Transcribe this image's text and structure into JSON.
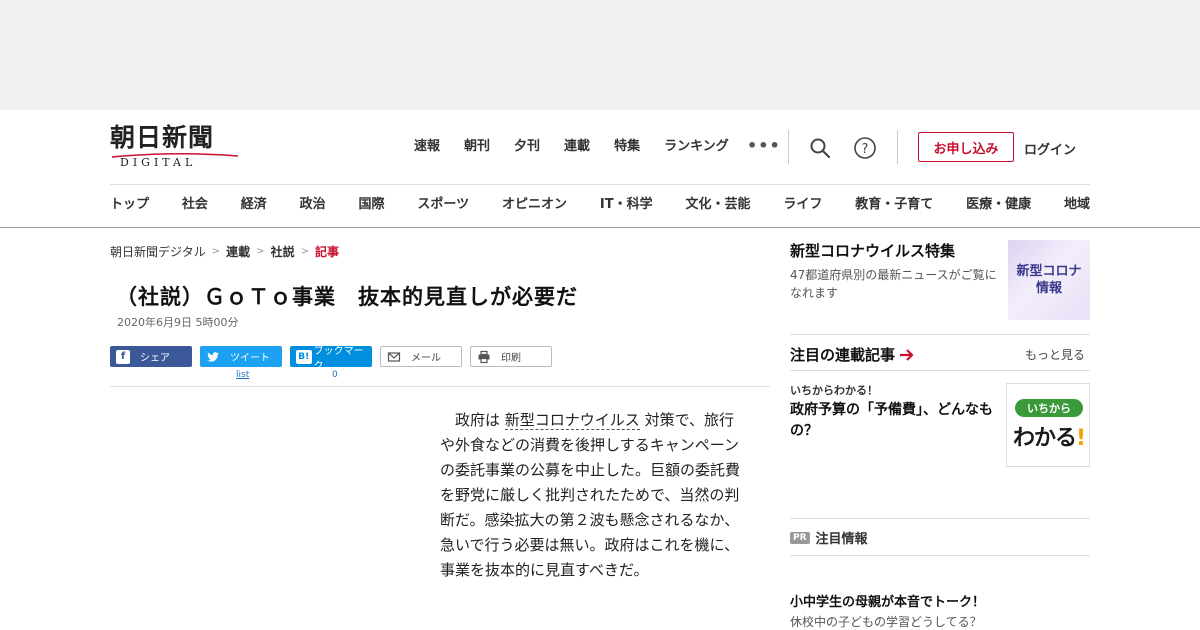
{
  "brand": {
    "logo_kanji": "朝日新聞",
    "logo_sub": "DIGITAL",
    "accent": "#c8102e"
  },
  "top_nav": [
    "速報",
    "朝刊",
    "夕刊",
    "連載",
    "特集",
    "ランキング"
  ],
  "more_icon": "more-dots-icon",
  "header_actions": {
    "search_icon": "search-icon",
    "help_icon": "help-icon",
    "subscribe_label": "お申し込み",
    "login_label": "ログイン"
  },
  "category_nav": [
    "トップ",
    "社会",
    "経済",
    "政治",
    "国際",
    "スポーツ",
    "オピニオン",
    "IT・科学",
    "文化・芸能",
    "ライフ",
    "教育・子育て",
    "医療・健康",
    "地域"
  ],
  "breadcrumb": [
    "朝日新聞デジタル",
    "連載",
    "社説",
    "記事"
  ],
  "article": {
    "headline": "（社説）ＧｏＴｏ事業　抜本的見直しが必要だ",
    "date": "2020年6月9日 5時00分",
    "body_before": "政府は ",
    "body_keyword": "新型コロナウイルス",
    "body_after": " 対策で、旅行や外食などの消費を後押しするキャンペーンの委託事業の公募を中止した。巨額の委託費を野党に厳しく批判されたためで、当然の判断だ。感染拡大の第２波も懸念されるなか、急いで行う必要は無い。政府はこれを機に、事業を抜本的に見直すべきだ。"
  },
  "share": {
    "facebook": "シェア",
    "twitter": "ツイート",
    "twitter_count": "list",
    "hatena": "ブックマーク",
    "hatena_count": "0",
    "mail": "メール",
    "print": "印刷"
  },
  "sidebar": {
    "corona": {
      "title": "新型コロナウイルス特集",
      "desc": "47都道府県別の最新ニュースがご覧になれます",
      "thumb_line1": "新型コロナ",
      "thumb_line2": "情報"
    },
    "series": {
      "title": "注目の連載記事",
      "more": "もっと見る",
      "kicker": "いちからわかる！",
      "headline": "政府予算の「予備費」、どんなもの？",
      "thumb_badge": "いちから",
      "thumb_big": "わかる",
      "thumb_bang": "!"
    },
    "pr": {
      "tag": "PR",
      "label": "注目情報"
    },
    "ad": {
      "title": "小中学生の母親が本音でトーク！",
      "desc": "休校中の子どもの学習どうしてる？"
    }
  }
}
